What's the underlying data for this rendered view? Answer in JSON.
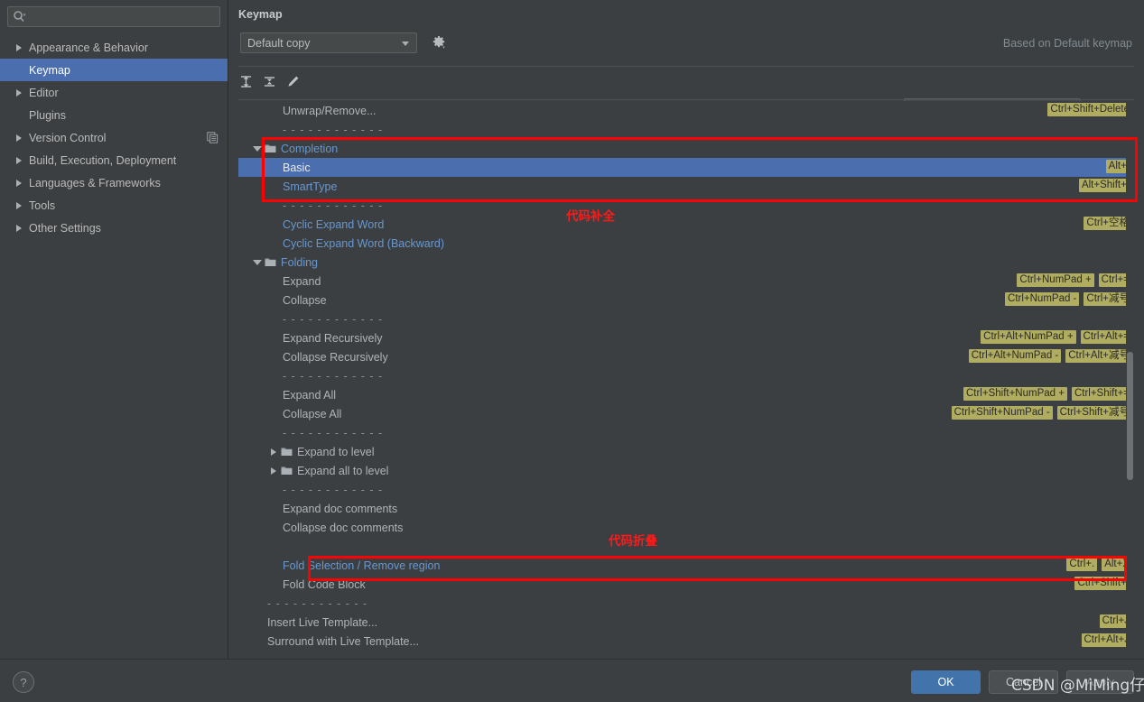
{
  "sidebar": {
    "search_placeholder": "",
    "search_value": "",
    "items": [
      {
        "label": "Appearance & Behavior",
        "expandable": true,
        "selected": false,
        "extra_icon": ""
      },
      {
        "label": "Keymap",
        "expandable": false,
        "selected": true,
        "extra_icon": ""
      },
      {
        "label": "Editor",
        "expandable": true,
        "selected": false,
        "extra_icon": ""
      },
      {
        "label": "Plugins",
        "expandable": false,
        "selected": false,
        "extra_icon": ""
      },
      {
        "label": "Version Control",
        "expandable": true,
        "selected": false,
        "extra_icon": "copy-icon"
      },
      {
        "label": "Build, Execution, Deployment",
        "expandable": true,
        "selected": false,
        "extra_icon": ""
      },
      {
        "label": "Languages & Frameworks",
        "expandable": true,
        "selected": false,
        "extra_icon": ""
      },
      {
        "label": "Tools",
        "expandable": true,
        "selected": false,
        "extra_icon": ""
      },
      {
        "label": "Other Settings",
        "expandable": true,
        "selected": false,
        "extra_icon": ""
      }
    ]
  },
  "panel": {
    "title": "Keymap",
    "keymap_select_value": "Default copy",
    "based_on": "Based on Default keymap",
    "gear_icon": "gear-icon",
    "toolbar": {
      "expand_all_icon": "expand-all-icon",
      "collapse_all_icon": "collapse-all-icon",
      "edit_icon": "pencil-edit-icon",
      "search_placeholder": "",
      "search_value": "",
      "find_action_icon": "find-action-icon"
    }
  },
  "tree": {
    "rows": [
      {
        "type": "action",
        "indent": 1,
        "label": "Unwrap/Remove...",
        "style": "plain",
        "shortcuts": [
          "Ctrl+Shift+Delete"
        ]
      },
      {
        "type": "separator",
        "indent": 1,
        "label": "- - - - - - - - - - - -",
        "style": "plain",
        "shortcuts": []
      },
      {
        "type": "group",
        "indent": 0,
        "label": "Completion",
        "style": "group",
        "expanded": true,
        "shortcuts": []
      },
      {
        "type": "action",
        "indent": 1,
        "label": "Basic",
        "style": "link",
        "selected": true,
        "shortcuts": [
          "Alt+/"
        ]
      },
      {
        "type": "action",
        "indent": 1,
        "label": "SmartType",
        "style": "link",
        "shortcuts": [
          "Alt+Shift+/"
        ]
      },
      {
        "type": "separator",
        "indent": 1,
        "label": "- - - - - - - - - - - -",
        "style": "plain",
        "shortcuts": []
      },
      {
        "type": "action",
        "indent": 1,
        "label": "Cyclic Expand Word",
        "style": "link",
        "shortcuts": [
          "Ctrl+空格"
        ]
      },
      {
        "type": "action",
        "indent": 1,
        "label": "Cyclic Expand Word (Backward)",
        "style": "link",
        "shortcuts": []
      },
      {
        "type": "group",
        "indent": 0,
        "label": "Folding",
        "style": "group",
        "expanded": true,
        "shortcuts": []
      },
      {
        "type": "action",
        "indent": 1,
        "label": "Expand",
        "style": "plain",
        "shortcuts": [
          "Ctrl+NumPad +",
          "Ctrl+="
        ]
      },
      {
        "type": "action",
        "indent": 1,
        "label": "Collapse",
        "style": "plain",
        "shortcuts": [
          "Ctrl+NumPad -",
          "Ctrl+减号"
        ]
      },
      {
        "type": "separator",
        "indent": 1,
        "label": "- - - - - - - - - - - -",
        "style": "plain",
        "shortcuts": []
      },
      {
        "type": "action",
        "indent": 1,
        "label": "Expand Recursively",
        "style": "plain",
        "shortcuts": [
          "Ctrl+Alt+NumPad +",
          "Ctrl+Alt+="
        ]
      },
      {
        "type": "action",
        "indent": 1,
        "label": "Collapse Recursively",
        "style": "plain",
        "shortcuts": [
          "Ctrl+Alt+NumPad -",
          "Ctrl+Alt+减号"
        ]
      },
      {
        "type": "separator",
        "indent": 1,
        "label": "- - - - - - - - - - - -",
        "style": "plain",
        "shortcuts": []
      },
      {
        "type": "action",
        "indent": 1,
        "label": "Expand All",
        "style": "plain",
        "shortcuts": [
          "Ctrl+Shift+NumPad +",
          "Ctrl+Shift+="
        ]
      },
      {
        "type": "action",
        "indent": 1,
        "label": "Collapse All",
        "style": "plain",
        "shortcuts": [
          "Ctrl+Shift+NumPad -",
          "Ctrl+Shift+减号"
        ]
      },
      {
        "type": "separator",
        "indent": 1,
        "label": "- - - - - - - - - - - -",
        "style": "plain",
        "shortcuts": []
      },
      {
        "type": "group",
        "indent": 1,
        "label": "Expand to level",
        "style": "plain",
        "expanded": false,
        "shortcuts": []
      },
      {
        "type": "group",
        "indent": 1,
        "label": "Expand all to level",
        "style": "plain",
        "expanded": false,
        "shortcuts": []
      },
      {
        "type": "separator",
        "indent": 1,
        "label": "- - - - - - - - - - - -",
        "style": "plain",
        "shortcuts": []
      },
      {
        "type": "action",
        "indent": 1,
        "label": "Expand doc comments",
        "style": "plain",
        "shortcuts": []
      },
      {
        "type": "action",
        "indent": 1,
        "label": "Collapse doc comments",
        "style": "plain",
        "shortcuts": []
      },
      {
        "type": "spacer",
        "indent": 1,
        "label": "",
        "style": "plain",
        "shortcuts": []
      },
      {
        "type": "action",
        "indent": 1,
        "label": "Fold Selection / Remove region",
        "style": "link",
        "shortcuts": [
          "Ctrl+.",
          "Alt+X"
        ]
      },
      {
        "type": "action",
        "indent": 1,
        "label": "Fold Code Block",
        "style": "plain",
        "shortcuts": [
          "Ctrl+Shift+."
        ]
      },
      {
        "type": "separator",
        "indent": 0,
        "label": "- - - - - - - - - - - -",
        "style": "plain",
        "shortcuts": []
      },
      {
        "type": "action",
        "indent": 0,
        "label": "Insert Live Template...",
        "style": "plain",
        "shortcuts": [
          "Ctrl+J"
        ]
      },
      {
        "type": "action",
        "indent": 0,
        "label": "Surround with Live Template...",
        "style": "plain",
        "shortcuts": [
          "Ctrl+Alt+J"
        ]
      }
    ]
  },
  "annotations": {
    "completion_label": "代码补全",
    "folding_label": "代码折叠",
    "box_color": "#ff0000"
  },
  "bottom": {
    "help_icon": "question-mark-icon",
    "ok_label": "OK",
    "cancel_label": "Cancel",
    "apply_label": "Apply"
  },
  "watermark": {
    "text": "CSDN @MiMing仔"
  }
}
